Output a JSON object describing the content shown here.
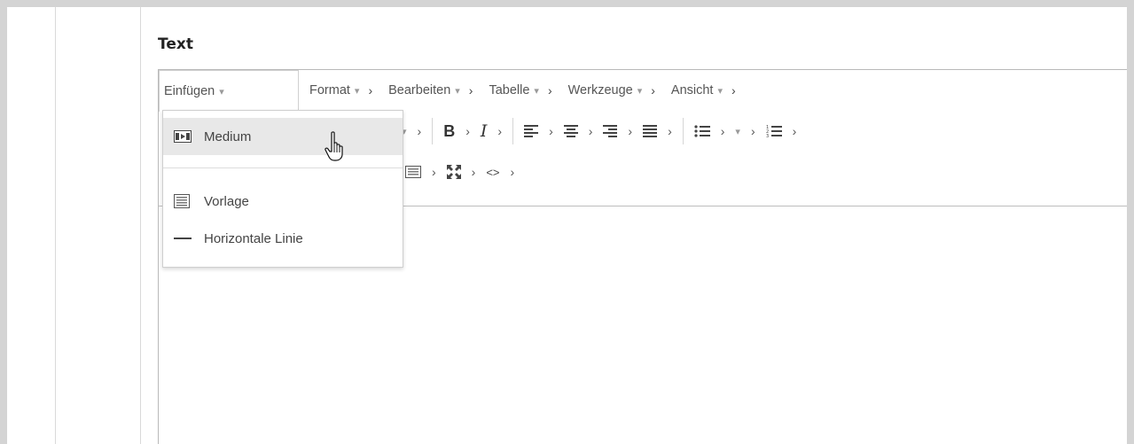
{
  "field": {
    "label": "Text"
  },
  "menubar": {
    "items": [
      {
        "label": "Einfügen",
        "dropdown": true,
        "open": true
      },
      {
        "label": "Format",
        "dropdown": true
      },
      {
        "label": "Bearbeiten",
        "dropdown": true
      },
      {
        "label": "Tabelle",
        "dropdown": true
      },
      {
        "label": "Werkzeuge",
        "dropdown": true
      },
      {
        "label": "Ansicht",
        "dropdown": true
      }
    ],
    "caret": "▾",
    "chevron": "›"
  },
  "toolbar": {
    "row1_icons": [
      "caret-down-icon",
      "bold-icon",
      "italic-icon",
      "align-left-icon",
      "align-center-icon",
      "align-right-icon",
      "align-justify-icon",
      "bullet-list-icon",
      "caret-down-icon",
      "numbered-list-icon"
    ],
    "bold": "B",
    "italic": "I",
    "row2_icons": [
      "template-icon",
      "fullscreen-icon",
      "source-code-icon"
    ],
    "code": "<>"
  },
  "dropdown": {
    "items": [
      {
        "label": "Medium",
        "icon": "media-icon",
        "hover": true
      },
      {
        "label": "Vorlage",
        "icon": "template-icon"
      },
      {
        "label": "Horizontale Linie",
        "icon": "horizontal-rule-icon"
      }
    ]
  },
  "colors": {
    "background": "#d4d4d4",
    "hover": "#e8e8e8",
    "border": "#b9b9b9"
  }
}
